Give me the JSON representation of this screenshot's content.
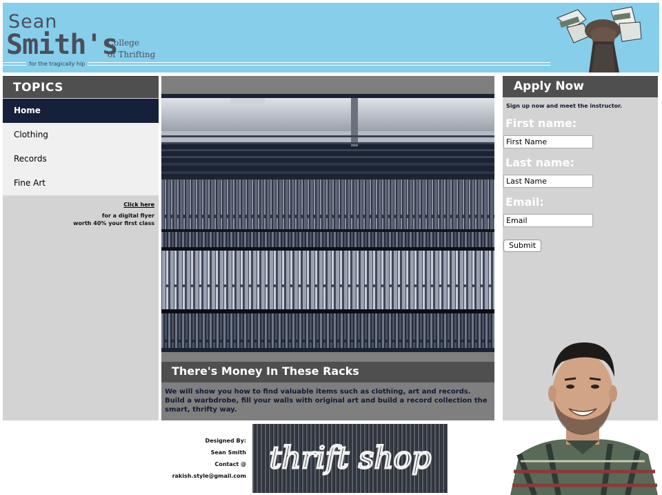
{
  "header": {
    "logo_line1": "Sean",
    "logo_line2": "Smith's",
    "logo_sub1": "College",
    "logo_sub2": "of Thrifting",
    "tagline": "for the tragically hip"
  },
  "sidebar": {
    "heading": "TOPICS",
    "items": [
      {
        "label": "Home",
        "active": true
      },
      {
        "label": "Clothing"
      },
      {
        "label": "Records"
      },
      {
        "label": "Fine Art"
      }
    ],
    "promo_link": "Click here",
    "promo_line1": "for a digital flyer",
    "promo_line2": "worth 40% your first class"
  },
  "main": {
    "title": "There's Money In These Racks",
    "body": "We will show you how to find valuable items such as clothing, art and records. Build a warbdrobe, fill your walls with original art and build a record collection the smart, thrifty way."
  },
  "apply": {
    "heading": "Apply Now",
    "subtitle": "Sign up now and meet the instructor.",
    "first_label": "First name:",
    "first_value": "First Name",
    "last_label": "Last name:",
    "last_value": "Last Name",
    "email_label": "Email:",
    "email_value": "Email",
    "submit": "Submit"
  },
  "footer": {
    "line1": "Designed By:",
    "line2": "Sean Smith",
    "line3": "Contact @",
    "line4": "rakish.style@gmail.com",
    "sign_text": "thrift shop"
  },
  "colors": {
    "header_bg": "#87ceeb",
    "nav_active": "#15203a",
    "panel_gray": "#d3d3d3",
    "heading_bar": "#4f4f4f"
  }
}
